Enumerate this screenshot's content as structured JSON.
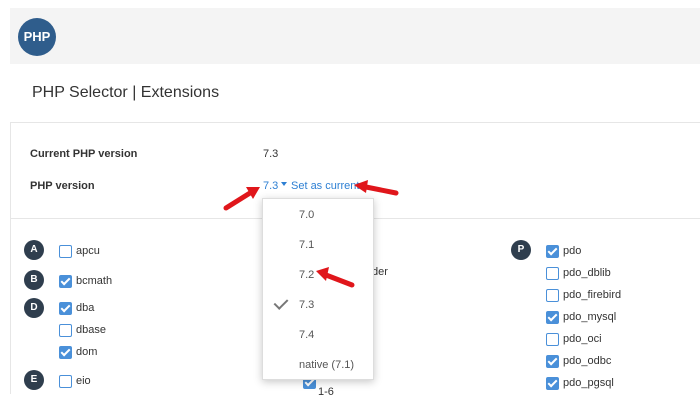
{
  "logo": {
    "text": "PHP"
  },
  "page": {
    "title": "PHP Selector | Extensions"
  },
  "current": {
    "label": "Current PHP version",
    "value": "7.3"
  },
  "version": {
    "label": "PHP version",
    "selected": "7.3",
    "set_current": "Set as current"
  },
  "dropdown": {
    "options": [
      "7.0",
      "7.1",
      "7.2",
      "7.3",
      "7.4",
      "native (7.1)"
    ],
    "checked": "7.3"
  },
  "extensions": {
    "col1": {
      "letters": [
        "A",
        "B",
        "D",
        "E"
      ],
      "items": [
        {
          "name": "apcu",
          "checked": false
        },
        {
          "name": "bcmath",
          "checked": true
        },
        {
          "name": "dba",
          "checked": true
        },
        {
          "name": "dbase",
          "checked": false
        },
        {
          "name": "dom",
          "checked": true
        },
        {
          "name": "eio",
          "checked": false
        }
      ]
    },
    "col2": {
      "partial_text": "der",
      "bottom_partial": "1-6"
    },
    "col3": {
      "letters": [
        "P"
      ],
      "items": [
        {
          "name": "pdo",
          "checked": true
        },
        {
          "name": "pdo_dblib",
          "checked": false
        },
        {
          "name": "pdo_firebird",
          "checked": false
        },
        {
          "name": "pdo_mysql",
          "checked": true
        },
        {
          "name": "pdo_oci",
          "checked": false
        },
        {
          "name": "pdo_odbc",
          "checked": true
        },
        {
          "name": "pdo_pgsql",
          "checked": true
        }
      ]
    }
  },
  "colors": {
    "accent": "#2d7fd3",
    "arrow": "#e0161b",
    "letter_bg": "#2f3e4e",
    "checkbox": "#4a90d9"
  }
}
